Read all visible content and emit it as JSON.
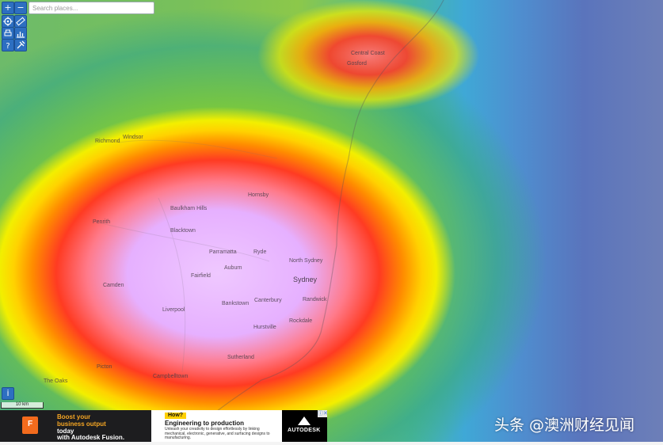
{
  "map": {
    "search": {
      "placeholder": "Search places..."
    },
    "controls": {
      "zoom_in": "+",
      "zoom_out": "−",
      "info": "i"
    },
    "scale_label": "10 km",
    "places": [
      {
        "label": "Central Coast",
        "major": false
      },
      {
        "label": "Gosford",
        "major": false
      },
      {
        "label": "Hornsby",
        "major": false
      },
      {
        "label": "Penrith",
        "major": false
      },
      {
        "label": "Blacktown",
        "major": false
      },
      {
        "label": "Parramatta",
        "major": false
      },
      {
        "label": "Ryde",
        "major": false
      },
      {
        "label": "Fairfield",
        "major": false
      },
      {
        "label": "Auburn",
        "major": false
      },
      {
        "label": "Sydney",
        "major": true
      },
      {
        "label": "Bankstown",
        "major": false
      },
      {
        "label": "Canterbury",
        "major": false
      },
      {
        "label": "Randwick",
        "major": false
      },
      {
        "label": "Hurstville",
        "major": false
      },
      {
        "label": "Rockdale",
        "major": false
      },
      {
        "label": "Sutherland",
        "major": false
      },
      {
        "label": "Campbelltown",
        "major": false
      },
      {
        "label": "North Sydney",
        "major": false
      },
      {
        "label": "Liverpool",
        "major": false
      },
      {
        "label": "Baulkham Hills",
        "major": false
      },
      {
        "label": "Windsor",
        "major": false
      },
      {
        "label": "Richmond",
        "major": false
      },
      {
        "label": "The Oaks",
        "major": false
      },
      {
        "label": "Picton",
        "major": false
      },
      {
        "label": "Camden",
        "major": false
      }
    ]
  },
  "ad": {
    "logo_text": "F",
    "headline_1": "Boost your",
    "headline_2": "business output",
    "headline_3": "today",
    "headline_4": "with Autodesk Fusion.",
    "badge": "How?",
    "title": "Engineering to production",
    "body": "Unleash your creativity to design effortlessly by linking mechanical, electronic, generative, and surfacing designs to manufacturing.",
    "brand": "AUTODESK",
    "close": "ⓘ✕"
  },
  "watermark": "头条 @澳洲财经见闻",
  "colors": {
    "control_blue": "#2d6fc1",
    "heat_core": "#e6b0ff",
    "heat_red": "#ff3b22",
    "heat_yellow": "#f2ef00",
    "ocean_blue": "#5a74bc"
  }
}
